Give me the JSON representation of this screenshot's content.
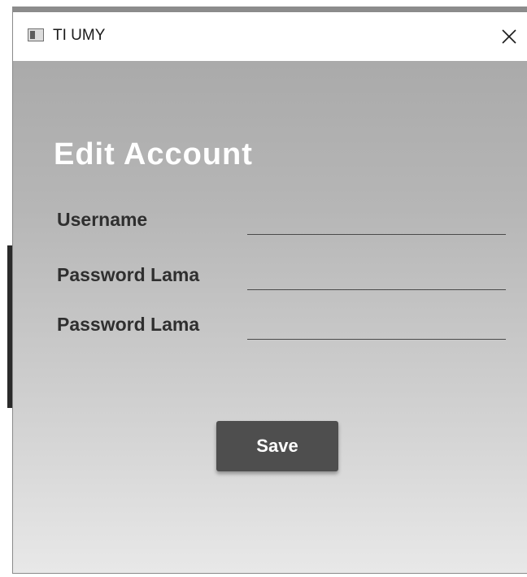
{
  "window": {
    "title": "TI UMY",
    "icon": "app-window-icon",
    "close_icon": "close-icon"
  },
  "form": {
    "heading": "Edit Account",
    "fields": [
      {
        "label": "Username",
        "value": "",
        "placeholder": ""
      },
      {
        "label": "Password Lama",
        "value": "",
        "placeholder": ""
      },
      {
        "label": "Password Lama",
        "value": "",
        "placeholder": ""
      }
    ],
    "save_label": "Save"
  },
  "colors": {
    "button_bg": "#4e4e4e",
    "heading_text": "#ffffff",
    "label_text": "#2f2f2f"
  }
}
